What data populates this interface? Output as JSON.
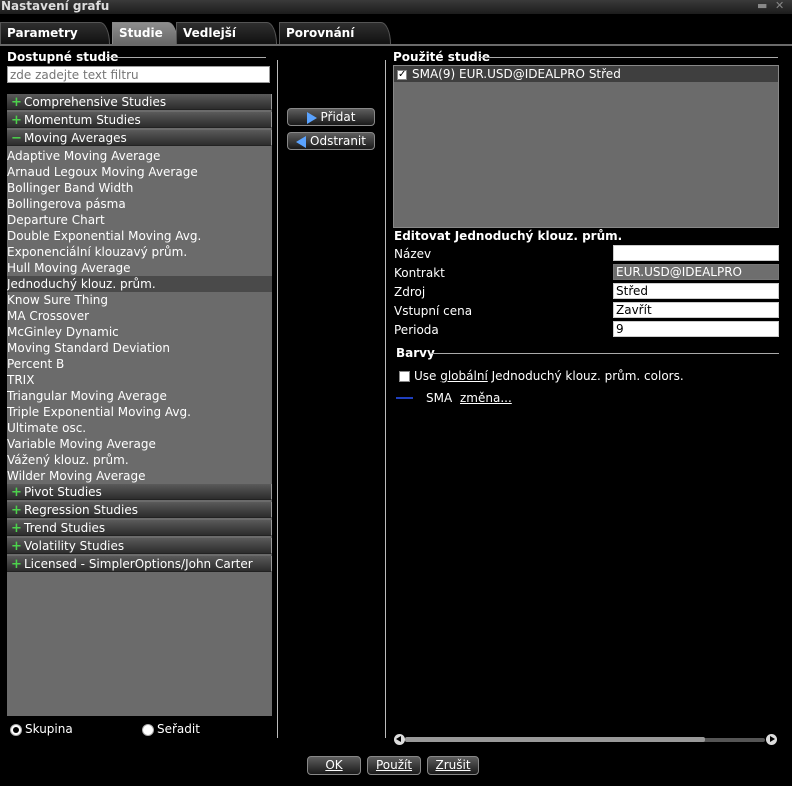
{
  "window": {
    "title": "Nastavení grafu",
    "min_icon": "minimize-icon",
    "close_icon": "close-icon"
  },
  "tabs": [
    {
      "label": "Parametry grafu",
      "active": false
    },
    {
      "label": "Studie",
      "active": true
    },
    {
      "label": "Vedlejší série",
      "active": false
    },
    {
      "label": "Porovnání indexů",
      "active": false
    }
  ],
  "left": {
    "title": "Dostupné studie",
    "filter_placeholder": "zde zadejte text filtru",
    "groups_top": [
      {
        "label": "Comprehensive Studies",
        "expanded": false
      },
      {
        "label": "Momentum Studies",
        "expanded": false
      },
      {
        "label": "Moving Averages",
        "expanded": true
      }
    ],
    "items": [
      "Adaptive Moving Average",
      "Arnaud Legoux Moving Average",
      "Bollinger Band Width",
      "Bollingerova pásma",
      "Departure Chart",
      "Double Exponential Moving Avg.",
      "Exponenciální klouzavý prům.",
      "Hull Moving Average",
      "Jednoduchý klouz. prům.",
      "Know Sure Thing",
      "MA Crossover",
      "McGinley Dynamic",
      "Moving Standard Deviation",
      "Percent B",
      "TRIX",
      "Triangular Moving Average",
      "Triple Exponential Moving Avg.",
      "Ultimate osc.",
      "Variable Moving Average",
      "Vážený klouz. prům.",
      "Wilder Moving Average"
    ],
    "selected_item": "Jednoduchý klouz. prům.",
    "groups_bottom": [
      {
        "label": "Pivot Studies"
      },
      {
        "label": "Regression Studies"
      },
      {
        "label": "Trend Studies"
      },
      {
        "label": "Volatility Studies"
      },
      {
        "label": "Licensed - SimplerOptions/John Carter"
      }
    ],
    "radio_group": {
      "option1": "Skupina",
      "option2": "Seřadit",
      "selected": "Skupina"
    }
  },
  "middle": {
    "add_label": "Přidat",
    "remove_label": "Odstranit"
  },
  "right": {
    "used_title": "Použité studie",
    "used_items": [
      {
        "label": "SMA(9) EUR.USD@IDEALPRO Střed",
        "checked": true
      }
    ],
    "edit_title": "Editovat Jednoduchý klouz. prům.",
    "fields": [
      {
        "label": "Název",
        "value": ""
      },
      {
        "label": "Kontrakt",
        "value": "EUR.USD@IDEALPRO"
      },
      {
        "label": "Zdroj",
        "value": "Střed"
      },
      {
        "label": "Vstupní cena",
        "value": "Zavřít"
      },
      {
        "label": "Perioda",
        "value": "9"
      }
    ],
    "colors_title": "Barvy",
    "use_global_prefix": "Use ",
    "use_global_link": "globální",
    "use_global_suffix": " Jednoduchý klouz. prům. colors.",
    "series_name": "SMA",
    "series_color": "#1f3fbf",
    "change_link": "změna..."
  },
  "footer": {
    "ok": "OK",
    "apply": "Použít",
    "cancel": "Zrušit"
  }
}
